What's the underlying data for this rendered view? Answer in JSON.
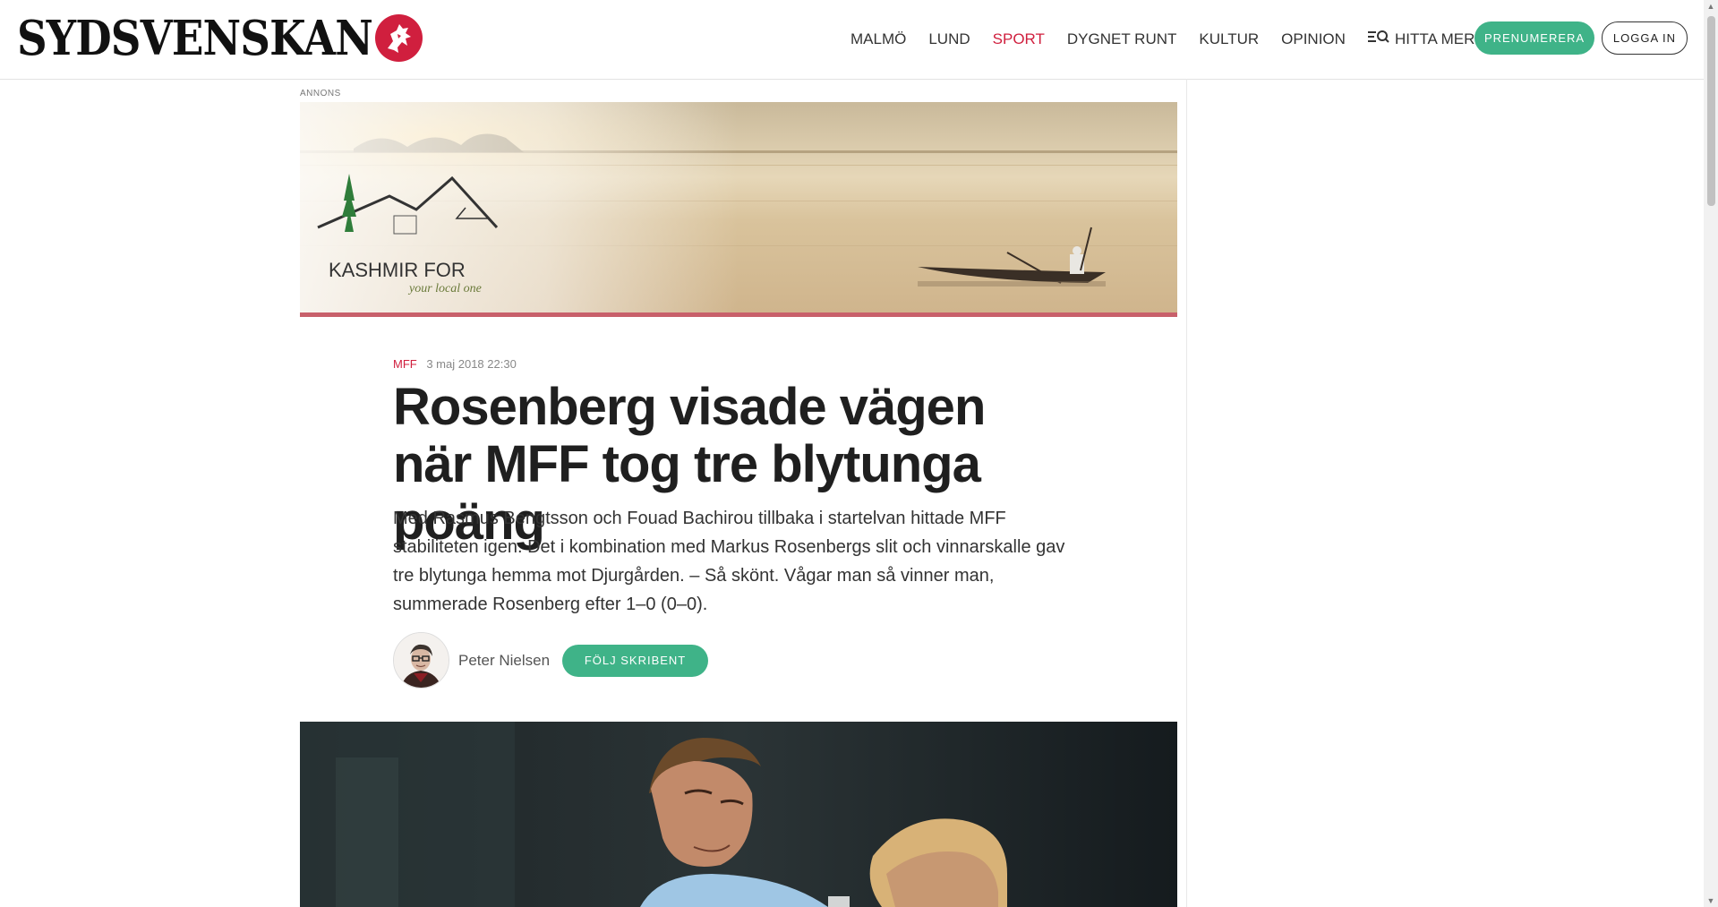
{
  "header": {
    "logo_text": "SYDSVENSKAN",
    "nav": [
      {
        "label": "MALMÖ",
        "active": false
      },
      {
        "label": "LUND",
        "active": false
      },
      {
        "label": "SPORT",
        "active": true
      },
      {
        "label": "DYGNET RUNT",
        "active": false
      },
      {
        "label": "KULTUR",
        "active": false
      },
      {
        "label": "OPINION",
        "active": false
      }
    ],
    "search_label": "HITTA MER",
    "subscribe_label": "PRENUMERERA",
    "login_label": "LOGGA IN"
  },
  "ad": {
    "label": "ANNONS",
    "brand": "KASHMIR FOR",
    "tagline": "your local one"
  },
  "article": {
    "category": "MFF",
    "date": "3 maj 2018 22:30",
    "headline": "Rosenberg visade vägen när MFF tog tre blytunga poäng",
    "lead": "Med Rasmus Bengtsson och Fouad Bachirou tillbaka i startelvan hittade MFF stabiliteten igen. Det i kombination med Markus Rosenbergs slit och vinnarskalle gav tre blytunga hemma mot Djurgården. – Så skönt. Vågar man så vinner man, summerade Rosenberg efter 1–0 (0–0).",
    "author": "Peter Nielsen",
    "follow_label": "FÖLJ SKRIBENT"
  },
  "colors": {
    "brand_red": "#d01f3e",
    "accent_green": "#3fb388"
  }
}
